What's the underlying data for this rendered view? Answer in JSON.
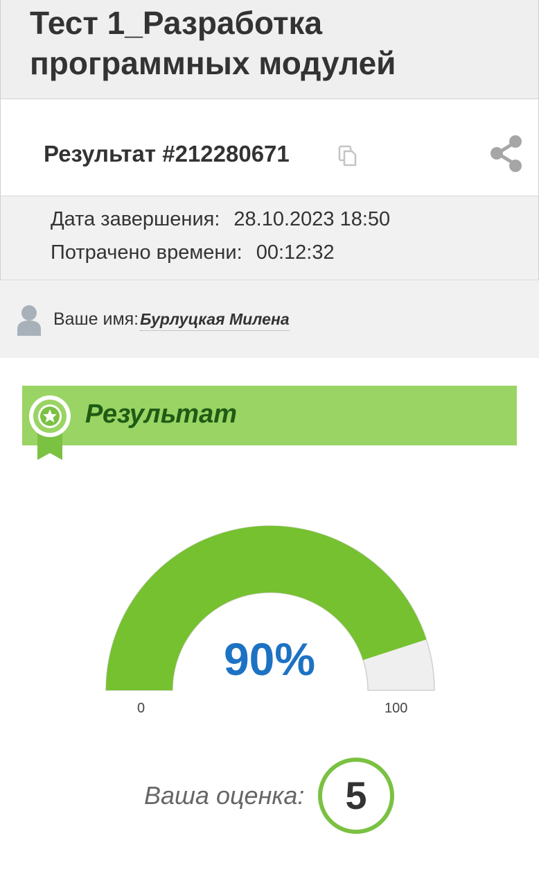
{
  "header": {
    "title": "Тест 1_Разработка программных модулей"
  },
  "result": {
    "title": "Результат #212280671",
    "copy_icon": "copy-icon",
    "share_icon": "share-icon"
  },
  "info": {
    "date_label": "Дата завершения:",
    "date_value": "28.10.2023 18:50",
    "time_label": "Потрачено времени:",
    "time_value": "00:12:32"
  },
  "user": {
    "icon": "user-icon",
    "label": "Ваше имя:",
    "name": "Бурлуцкая Милена"
  },
  "banner": {
    "title": "Результат",
    "icon": "award-badge-icon",
    "color": "#9ad464"
  },
  "gauge": {
    "percent": 90,
    "value_text": "90%",
    "min_label": "0",
    "max_label": "100",
    "fill_color": "#76c12f",
    "track_color": "#efefef"
  },
  "grade": {
    "label": "Ваша оценка:",
    "value": "5",
    "ring_color": "#7bc142"
  }
}
